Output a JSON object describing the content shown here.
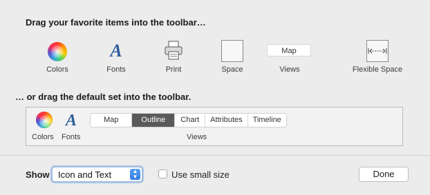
{
  "headings": {
    "drag_items": "Drag your favorite items into the toolbar…",
    "drag_default": "… or drag the default set into the toolbar."
  },
  "items": {
    "colors": "Colors",
    "fonts": "Fonts",
    "print": "Print",
    "space": "Space",
    "views": "Views",
    "views_chip": "Map",
    "flexible_space": "Flexible Space"
  },
  "default_set": {
    "colors": "Colors",
    "fonts": "Fonts",
    "views_label": "Views",
    "segments": [
      "Map",
      "Outline",
      "Chart",
      "Attributes",
      "Timeline"
    ],
    "selected_segment": "Outline"
  },
  "footer": {
    "show_label": "Show",
    "show_value": "Icon and Text",
    "small_size_label": "Use small size",
    "small_size_checked": false,
    "done_label": "Done"
  },
  "glyphs": {
    "font_letter": "A"
  },
  "colors": {
    "selected_segment_bg": "#5a5a5a",
    "popup_arrow_bg": "#2f7de0",
    "font_icon": "#2e5e9c"
  }
}
